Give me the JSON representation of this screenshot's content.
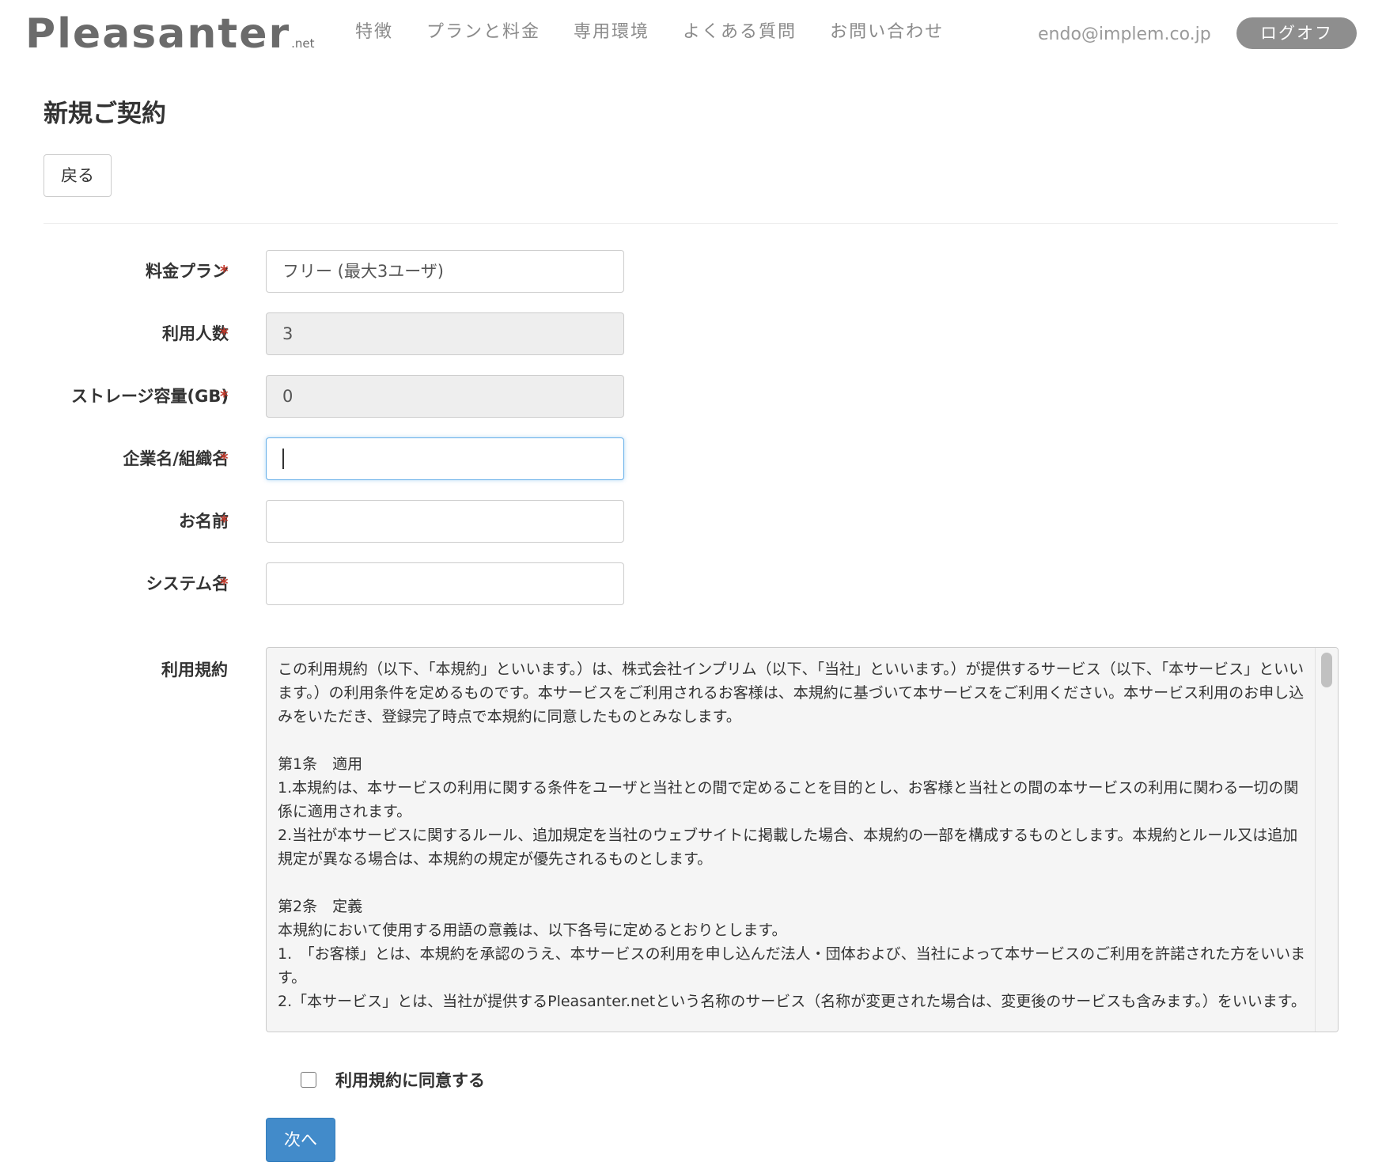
{
  "header": {
    "logo": "Pleasanter",
    "logo_suffix": ".net",
    "nav": [
      {
        "label": "特徴"
      },
      {
        "label": "プランと料金"
      },
      {
        "label": "専用環境"
      },
      {
        "label": "よくある質問"
      },
      {
        "label": "お問い合わせ"
      }
    ],
    "user_email": "endo@implem.co.jp",
    "logoff_label": "ログオフ"
  },
  "page": {
    "title": "新規ご契約",
    "back_label": "戻る",
    "required_mark": "*"
  },
  "form": {
    "plan": {
      "label": "料金プラン",
      "value": "フリー (最大3ユーザ)"
    },
    "users": {
      "label": "利用人数",
      "value": "3"
    },
    "storage": {
      "label": "ストレージ容量(GB)",
      "value": "0"
    },
    "company": {
      "label": "企業名/組織名",
      "value": ""
    },
    "name": {
      "label": "お名前",
      "value": ""
    },
    "system": {
      "label": "システム名",
      "value": ""
    }
  },
  "terms": {
    "label": "利用規約",
    "text": "この利用規約（以下、「本規約」といいます。）は、株式会社インプリム（以下、「当社」といいます。）が提供するサービス（以下、「本サービス」といいます。）の利用条件を定めるものです。本サービスをご利用されるお客様は、本規約に基づいて本サービスをご利用ください。本サービス利用のお申し込みをいただき、登録完了時点で本規約に同意したものとみなします。\n\n第1条　適用\n1.本規約は、本サービスの利用に関する条件をユーザと当社との間で定めることを目的とし、お客様と当社との間の本サービスの利用に関わる一切の関係に適用されます。\n2.当社が本サービスに関するルール、追加規定を当社のウェブサイトに掲載した場合、本規約の一部を構成するものとします。本規約とルール又は追加規定が異なる場合は、本規約の規定が優先されるものとします。\n\n第2条　定義\n本規約において使用する用語の意義は、以下各号に定めるとおりとします。\n1.　「お客様」とは、本規約を承認のうえ、本サービスの利用を申し込んだ法人・団体および、当社によって本サービスのご利用を許諾された方をいいます。\n2.「本サービス」とは、当社が提供するPleasanter.netという名称のサービス（名称が変更された場合は、変更後のサービスも含みます。）をいいます。",
    "agree_label": "利用規約に同意する",
    "agree_checked": false
  },
  "actions": {
    "next_label": "次へ"
  },
  "colors": {
    "primary": "#428bca",
    "logoff_bg": "#8e8e8e",
    "required": "#c0392b",
    "focus_border": "#66afe9"
  }
}
